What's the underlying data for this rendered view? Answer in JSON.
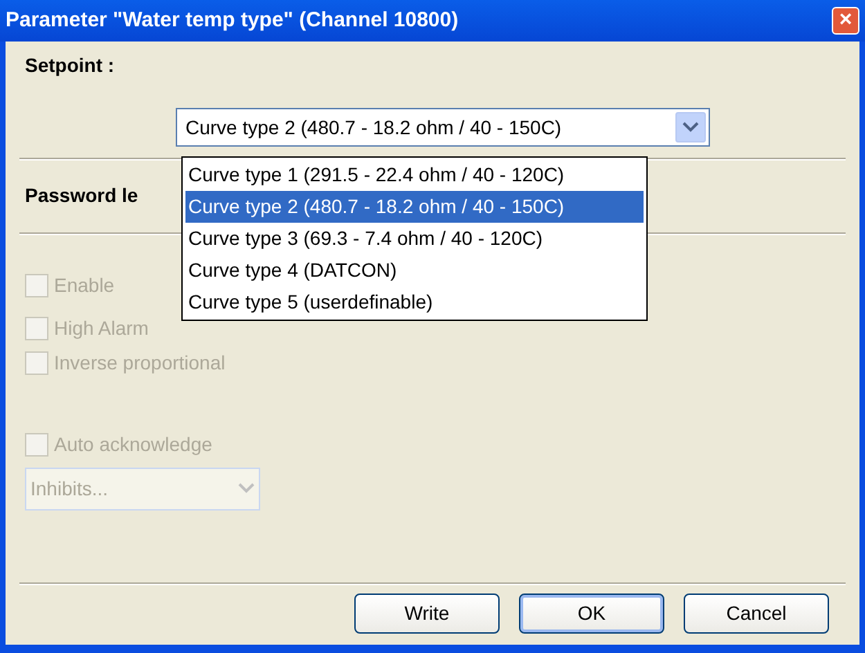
{
  "window": {
    "title": "Parameter \"Water temp type\" (Channel 10800)",
    "close": "×"
  },
  "setpoint": {
    "label": "Setpoint :",
    "value": "Curve type 2 (480.7 - 18.2 ohm / 40 - 150C)",
    "expanded": true,
    "options": [
      {
        "label": "Curve type 1 (291.5 - 22.4 ohm / 40 - 120C)",
        "selected": false
      },
      {
        "label": "Curve type 2 (480.7 - 18.2 ohm / 40 - 150C)",
        "selected": true
      },
      {
        "label": "Curve type 3 (69.3 - 7.4 ohm / 40 - 120C)",
        "selected": false
      },
      {
        "label": "Curve type 4 (DATCON)",
        "selected": false
      },
      {
        "label": "Curve type 5 (userdefinable)",
        "selected": false
      }
    ]
  },
  "password_label": "Password le",
  "checkboxes": [
    {
      "label": "Enable",
      "checked": false,
      "disabled": true
    },
    {
      "label": "High Alarm",
      "checked": false,
      "disabled": true
    },
    {
      "label": "Inverse proportional",
      "checked": false,
      "disabled": true
    },
    {
      "label": "Auto acknowledge",
      "checked": false,
      "disabled": true
    }
  ],
  "inhibits": {
    "value": "Inhibits...",
    "disabled": true
  },
  "buttons": [
    {
      "label": "Write",
      "default": false
    },
    {
      "label": "OK",
      "default": true
    },
    {
      "label": "Cancel",
      "default": false
    }
  ]
}
